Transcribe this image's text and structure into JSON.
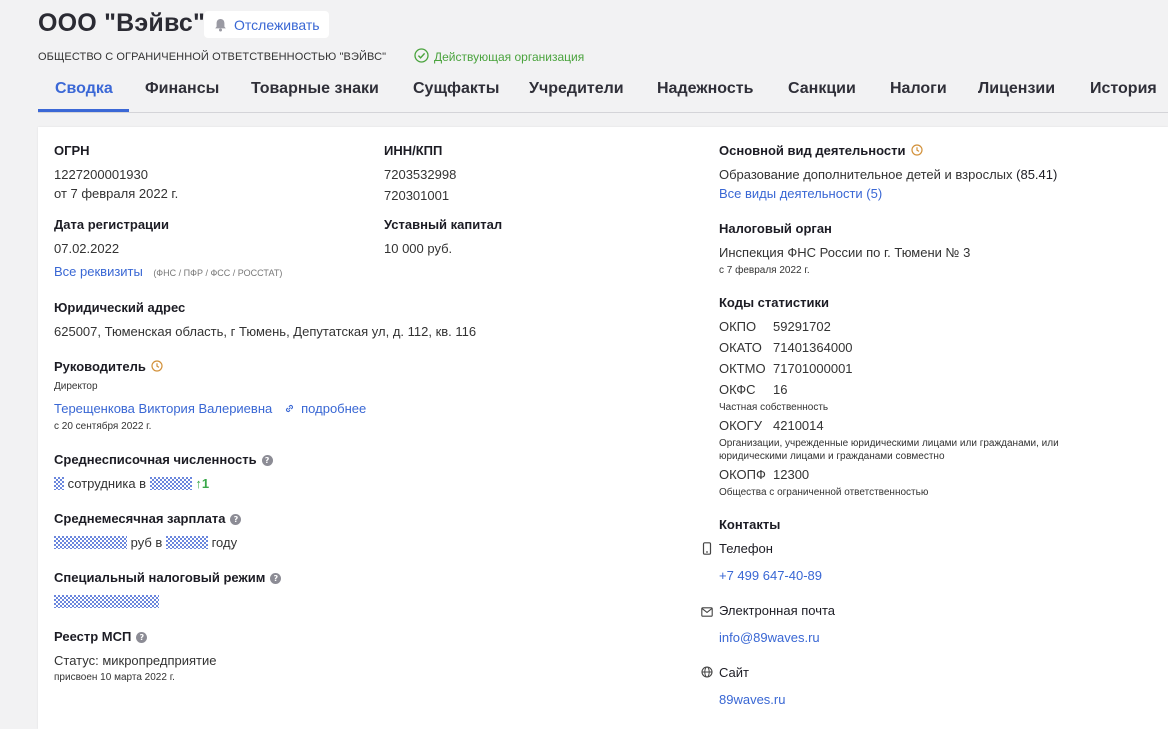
{
  "header": {
    "company_name": "ООО \"Вэйвс\"",
    "follow_label": "Отслеживать",
    "legal_name": "ОБЩЕСТВО С ОГРАНИЧЕННОЙ ОТВЕТСТВЕННОСТЬЮ \"ВЭЙВС\"",
    "status": "Действующая организация"
  },
  "tabs": [
    "Сводка",
    "Финансы",
    "Товарные знаки",
    "Сущфакты",
    "Учредители",
    "Надежность",
    "Санкции",
    "Налоги",
    "Лицензии",
    "История"
  ],
  "summary": {
    "ogrn_label": "ОГРН",
    "ogrn": "1227200001930",
    "ogrn_date": "от 7 февраля 2022 г.",
    "inn_kpp_label": "ИНН/КПП",
    "inn": "7203532998",
    "kpp": "720301001",
    "reg_date_label": "Дата регистрации",
    "reg_date": "07.02.2022",
    "capital_label": "Уставный капитал",
    "capital": "10 000 руб.",
    "all_details_link": "Все реквизиты",
    "all_details_note": "(ФНС / ПФР / ФСС / РОССТАТ)",
    "address_label": "Юридический адрес",
    "address": "625007, Тюменская область, г Тюмень, Депутатская ул, д. 112, кв. 116",
    "manager_label": "Руководитель",
    "manager_role": "Директор",
    "manager_name": "Терещенкова Виктория Валериевна",
    "manager_more": "подробнее",
    "manager_since": "с 20 сентября 2022 г.",
    "headcount_label": "Среднесписочная численность",
    "headcount_text": "сотрудника в",
    "headcount_growth": "1",
    "salary_label": "Среднемесячная зарплата",
    "salary_text1": "руб в",
    "salary_text2": "году",
    "tax_regime_label": "Специальный налоговый режим",
    "msp_label": "Реестр МСП",
    "msp_status": "Статус: микропредприятие",
    "msp_date": "присвоен 10 марта 2022 г."
  },
  "activity": {
    "label": "Основной вид деятельности",
    "text": "Образование дополнительное детей и взрослых",
    "code": "(85.41)",
    "all_link": "Все виды деятельности (5)"
  },
  "tax_office": {
    "label": "Налоговый орган",
    "name": "Инспекция ФНС России по г. Тюмени № 3",
    "since": "с 7 февраля 2022 г."
  },
  "stat_codes": {
    "label": "Коды статистики",
    "okpo_key": "ОКПО",
    "okpo": "59291702",
    "okato_key": "ОКАТО",
    "okato": "71401364000",
    "oktmo_key": "ОКТМО",
    "oktmo": "71701000001",
    "okfs_key": "ОКФС",
    "okfs": "16",
    "okfs_desc": "Частная собственность",
    "okogu_key": "ОКОГУ",
    "okogu": "4210014",
    "okogu_desc1": "Организации, учрежденные юридическими лицами или гражданами, или",
    "okogu_desc2": "юридическими лицами и гражданами совместно",
    "okopf_key": "ОКОПФ",
    "okopf": "12300",
    "okopf_desc": "Общества с ограниченной ответственностью"
  },
  "contacts": {
    "label": "Контакты",
    "phone_label": "Телефон",
    "phone": "+7 499 647-40-89",
    "email_label": "Электронная почта",
    "email": "info@89waves.ru",
    "site_label": "Сайт",
    "site": "89waves.ru"
  },
  "colors": {
    "accent": "#3b68d6",
    "status_green": "#4aa33d",
    "link": "#3967d4"
  }
}
